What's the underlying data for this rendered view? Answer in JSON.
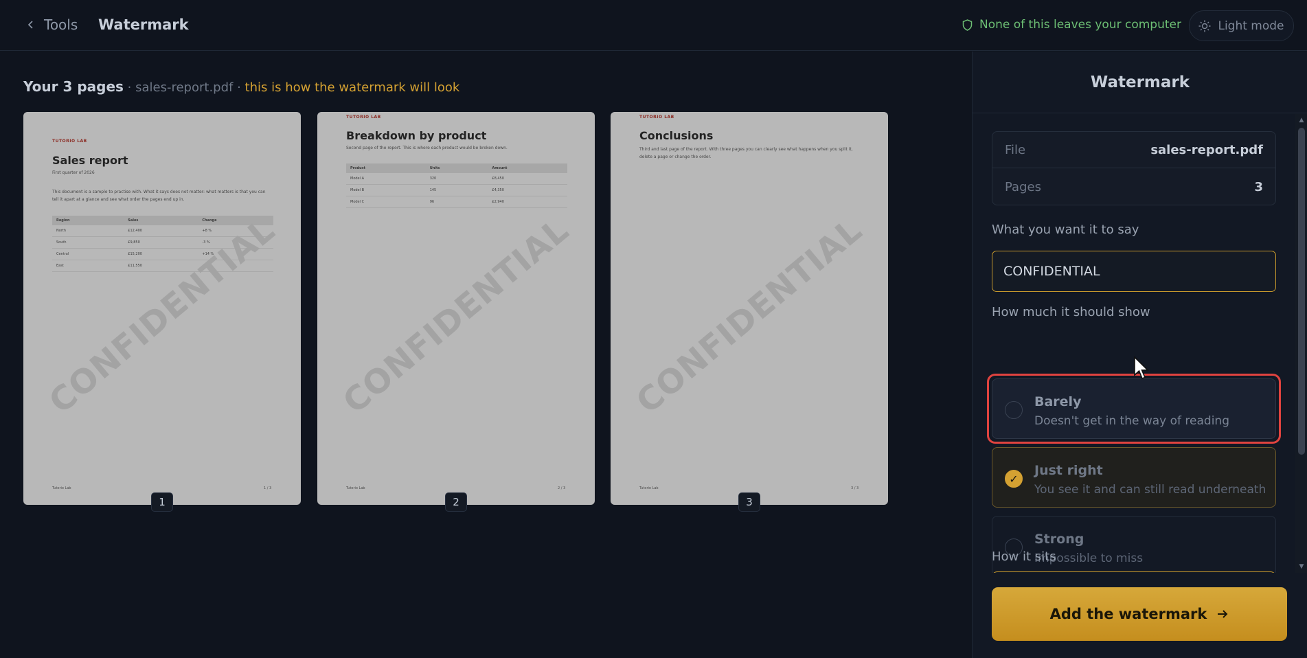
{
  "header": {
    "back_label": "Tools",
    "title": "Watermark",
    "privacy_note": "None of this leaves your computer",
    "theme_toggle": "Light mode"
  },
  "preview": {
    "count_label": "Your 3 pages",
    "file_part": "· sales-report.pdf ·",
    "hint": "this is how the watermark will look",
    "watermark_text": "CONFIDENTIAL",
    "pages": [
      {
        "number": "1",
        "brand": "TUTORIO LAB",
        "title": "Sales report",
        "subtitle": "First quarter of 2026",
        "paragraph": "This document is a sample to practise with. What it says does not matter: what matters is that you can tell it apart at a glance and see what order the pages end up in.",
        "table": {
          "headers": [
            "Region",
            "Sales",
            "Change"
          ],
          "rows": [
            [
              "North",
              "£12,400",
              "+8 %"
            ],
            [
              "South",
              "£9,850",
              "-3 %"
            ],
            [
              "Central",
              "£15,200",
              "+14 %"
            ],
            [
              "East",
              "£11,550",
              "+2 %"
            ]
          ]
        },
        "footer_left": "Tutorio Lab",
        "footer_right": "1 / 3"
      },
      {
        "number": "2",
        "brand": "TUTORIO LAB",
        "title": "Breakdown by product",
        "paragraph": "Second page of the report. This is where each product would be broken down.",
        "table": {
          "headers": [
            "Product",
            "Units",
            "Amount"
          ],
          "rows": [
            [
              "Model A",
              "320",
              "£8,450"
            ],
            [
              "Model B",
              "145",
              "£4,350"
            ],
            [
              "Model C",
              "96",
              "£2,940"
            ]
          ]
        },
        "footer_left": "Tutorio Lab",
        "footer_right": "2 / 3"
      },
      {
        "number": "3",
        "brand": "TUTORIO LAB",
        "title": "Conclusions",
        "paragraph": "Third and last page of the report. With three pages you can clearly see what happens when you split it, delete a page or change the order.",
        "footer_left": "Tutorio Lab",
        "footer_right": "3 / 3"
      }
    ]
  },
  "panel": {
    "title": "Watermark",
    "file_label": "File",
    "file_value": "sales-report.pdf",
    "pages_label": "Pages",
    "pages_value": "3",
    "text_label": "What you want it to say",
    "text_value": "CONFIDENTIAL",
    "opacity_label": "How much it should show",
    "options": [
      {
        "title": "Barely",
        "desc": "Doesn't get in the way of reading"
      },
      {
        "title": "Just right",
        "desc": "You see it and can still read underneath"
      },
      {
        "title": "Strong",
        "desc": "Impossible to miss"
      }
    ],
    "selected_check": "✓",
    "position_label": "How it sits",
    "submit_label": "Add the watermark"
  },
  "colors": {
    "background": "#0f141e",
    "panel": "#121824",
    "accent": "#d4a132",
    "privacy_green": "#6dbf74",
    "focus_ring": "#e0433f"
  }
}
